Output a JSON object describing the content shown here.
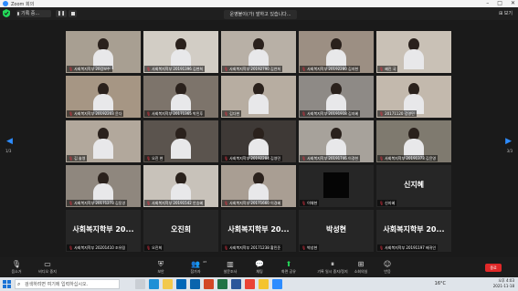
{
  "window": {
    "title": "Zoom 회의"
  },
  "meeting_bar": {
    "speaking_label": "기록 중...",
    "recording_status": "운영불이(가) 발하고 있습니다...",
    "view_label": "보기"
  },
  "nav": {
    "left_page": "1/3",
    "right_page": "3/3"
  },
  "tiles": [
    {
      "name": "사회복지학부 20김보수",
      "kind": "video",
      "bg": "#a89f92"
    },
    {
      "name": "사회복지학부 20191396 김현희",
      "kind": "video",
      "bg": "#d2cdc5"
    },
    {
      "name": "사회복지학부 20192790 김연희",
      "kind": "video",
      "bg": "#b8b0a6"
    },
    {
      "name": "사회복지학부 20192280 김지현",
      "kind": "video",
      "bg": "#9c8f83"
    },
    {
      "name": "혜진 국",
      "kind": "video",
      "bg": "#c9c1b6"
    },
    {
      "name": "사회복지학부 20192203 윤다",
      "kind": "video",
      "bg": "#a69684"
    },
    {
      "name": "사회복지학부 20171365 박민후",
      "kind": "video",
      "bg": "#7d746b"
    },
    {
      "name": "김다현",
      "kind": "video",
      "bg": "#b7ada1"
    },
    {
      "name": "사회복지학부 20191918 김지혜",
      "kind": "video",
      "bg": "#8e8a86"
    },
    {
      "name": "20171120 김영민",
      "kind": "video",
      "bg": "#c3b9ad"
    },
    {
      "name": "김 솔영",
      "kind": "video",
      "bg": "#b2a89c"
    },
    {
      "name": "오진 현",
      "kind": "video",
      "bg": "#5b544e"
    },
    {
      "name": "사회복지학부 20192284 김영민",
      "kind": "video",
      "bg": "#3e3936"
    },
    {
      "name": "사회복지학부 20191746 이경현",
      "kind": "video",
      "bg": "#a7a29b"
    },
    {
      "name": "사회복지학부 20191373 김윤영",
      "kind": "video",
      "bg": "#7f7a6f"
    },
    {
      "name": "사회복지학부 20171273 김동영",
      "kind": "video",
      "bg": "#8f877e"
    },
    {
      "name": "사회복지학부 20191542 안승혜",
      "kind": "video",
      "bg": "#c8c2ba"
    },
    {
      "name": "사회복지학부 20171660 이경혜",
      "kind": "video",
      "bg": "#a99e93"
    },
    {
      "name": "이채현",
      "kind": "black"
    },
    {
      "name": "신지혜",
      "kind": "text",
      "big": "신지혜"
    },
    {
      "name": "사회복지학부 20201410 조유림",
      "kind": "text",
      "big": "사회복지학부 20..."
    },
    {
      "name": "오진희",
      "kind": "text",
      "big": "오진희"
    },
    {
      "name": "사회복지학부 20171238 황민준",
      "kind": "text",
      "big": "사회복지학부 20..."
    },
    {
      "name": "박성현",
      "kind": "text",
      "big": "박성현"
    },
    {
      "name": "사회복지학부 20191197 배귀인",
      "kind": "text",
      "big": "사회복지학부 20..."
    }
  ],
  "toolbar": {
    "mute": "음소거",
    "video_stop": "비디오 중지",
    "security": "보안",
    "participants": "참가자",
    "participants_count": "43",
    "polls": "설문조사",
    "chat": "채팅",
    "share": "화면 공유",
    "record": "기록 일시 중지/정지",
    "breakout": "소회의실",
    "reactions": "반응",
    "end": "종료"
  },
  "taskbar": {
    "search_placeholder": "검색하려면 여기에 입력하십시오.",
    "temp": "16°C",
    "time": "오후 4:03",
    "date": "2021-11-18"
  },
  "colors": {
    "accent": "#2d8cff",
    "end": "#e02828",
    "share": "#23d959"
  }
}
